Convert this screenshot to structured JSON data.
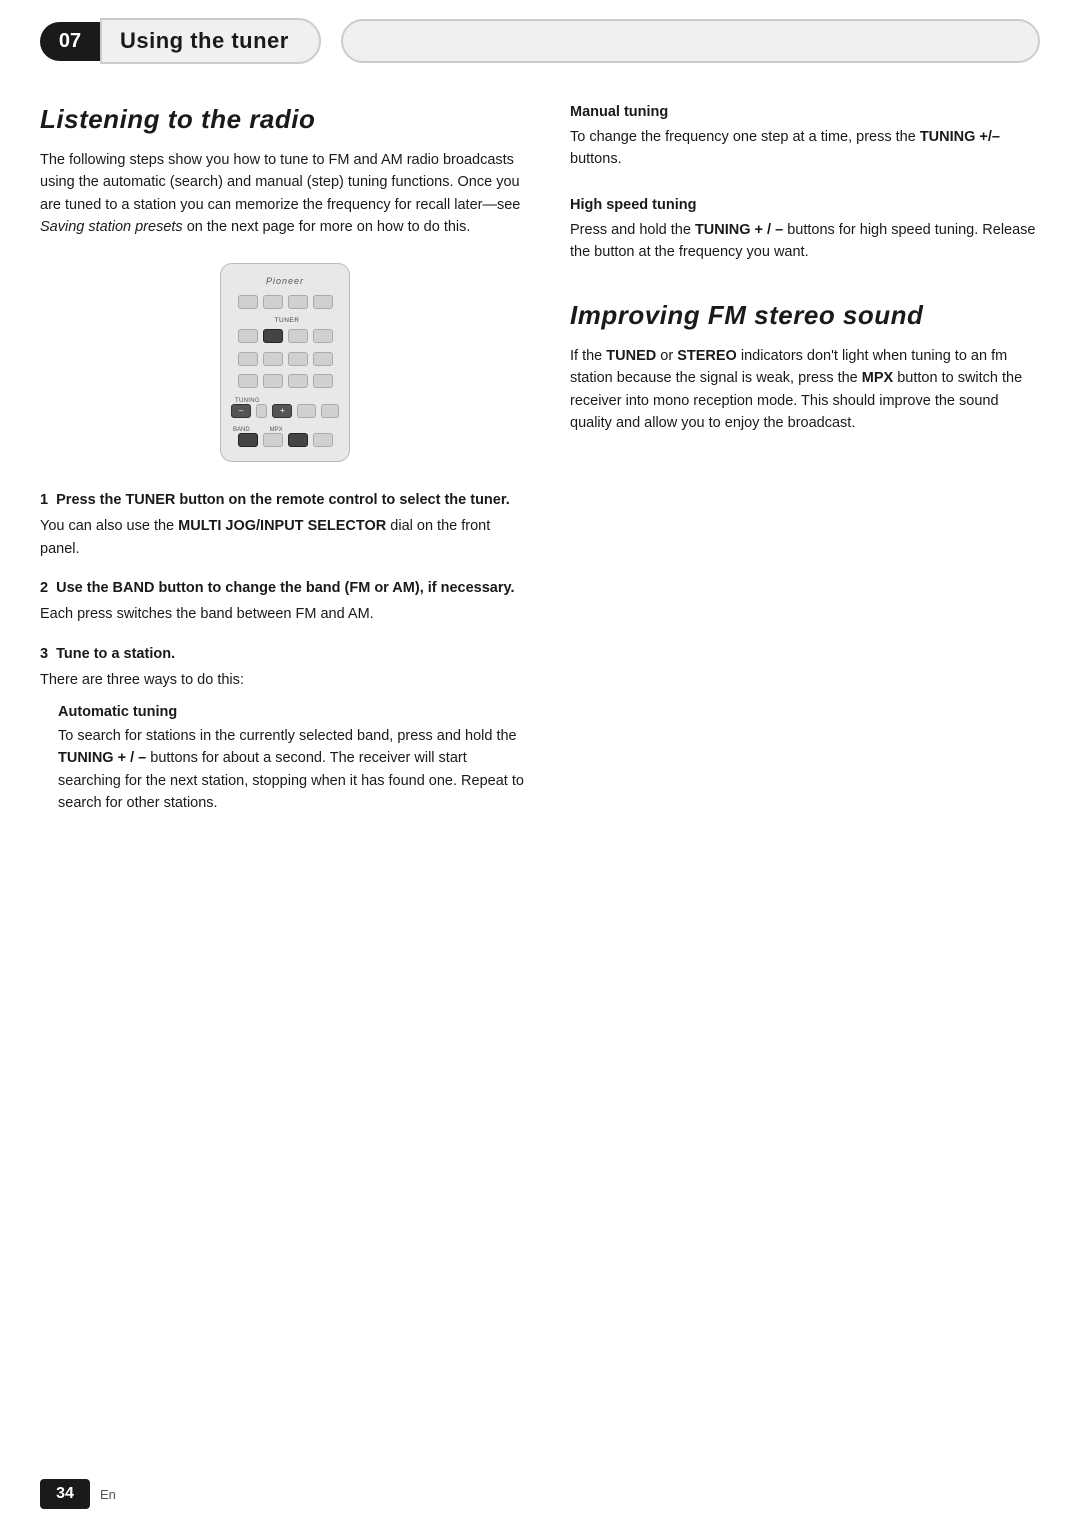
{
  "header": {
    "chapter_num": "07",
    "chapter_title": "Using the tuner"
  },
  "left": {
    "section_title": "Listening to the radio",
    "intro_text": "The following steps show you how to tune to FM and AM radio broadcasts using the automatic (search) and manual (step) tuning functions. Once you are tuned to a station you can memorize the frequency for recall later—see Saving station presets on the next page for more on how to do this.",
    "steps": [
      {
        "num": "1",
        "heading": "Press the TUNER button on the remote control to select the tuner.",
        "body": "You can also use the MULTI JOG/INPUT SELECTOR dial on the front panel.",
        "has_bold_body": true
      },
      {
        "num": "2",
        "heading": "Use the BAND button to change the band (FM or AM), if necessary.",
        "body": "Each press switches the band between FM and AM.",
        "has_bold_heading": true
      },
      {
        "num": "3",
        "heading": "Tune to a station.",
        "body": "There are three ways to do this:",
        "sub_sections": [
          {
            "sub_heading": "Automatic tuning",
            "sub_body": "To search for stations in the currently selected band, press and hold the TUNING + / – buttons for about a second. The receiver will start searching for the next station, stopping when it has found one. Repeat to search for other stations."
          }
        ]
      }
    ]
  },
  "right": {
    "tuning_sub_sections": [
      {
        "heading": "Manual tuning",
        "body": "To change the frequency one step at a time, press the TUNING +/– buttons."
      },
      {
        "heading": "High speed tuning",
        "body": "Press and hold the TUNING + / – buttons for high speed tuning. Release the button at the frequency you want."
      }
    ],
    "improving_section": {
      "title": "Improving FM stereo sound",
      "body": "If the TUNED or STEREO indicators don't light when tuning to an fm station because the signal is weak, press the MPX button to switch the receiver into mono reception mode. This should improve the sound quality and allow you to enjoy the broadcast."
    }
  },
  "remote": {
    "brand": "Pioneer"
  },
  "footer": {
    "page_num": "34",
    "lang": "En"
  }
}
